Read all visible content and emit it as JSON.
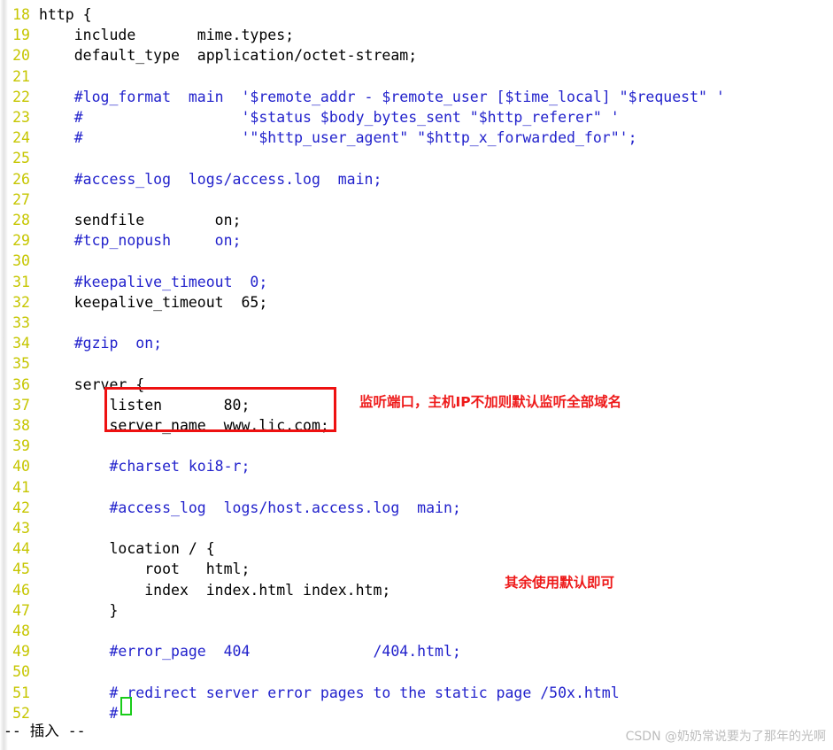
{
  "editor": {
    "mode_status": "-- 插入 --",
    "colors": {
      "line_number": "#c6c600",
      "comment": "#2222cc",
      "code": "#000000",
      "background": "#ffffff",
      "annotation_red": "#ee1a1a",
      "highlight_box": "#ee1111",
      "cursor_green": "#19cc19",
      "watermark": "#bdbdbd"
    },
    "lines": [
      {
        "n": "18",
        "text": "http {",
        "comment": false
      },
      {
        "n": "19",
        "text": "    include       mime.types;",
        "comment": false
      },
      {
        "n": "20",
        "text": "    default_type  application/octet-stream;",
        "comment": false
      },
      {
        "n": "21",
        "text": "",
        "comment": false
      },
      {
        "n": "22",
        "text": "    #log_format  main  '$remote_addr - $remote_user [$time_local] \"$request\" '",
        "comment": true
      },
      {
        "n": "23",
        "text": "    #                  '$status $body_bytes_sent \"$http_referer\" '",
        "comment": true
      },
      {
        "n": "24",
        "text": "    #                  '\"$http_user_agent\" \"$http_x_forwarded_for\"';",
        "comment": true
      },
      {
        "n": "25",
        "text": "",
        "comment": false
      },
      {
        "n": "26",
        "text": "    #access_log  logs/access.log  main;",
        "comment": true
      },
      {
        "n": "27",
        "text": "",
        "comment": false
      },
      {
        "n": "28",
        "text": "    sendfile        on;",
        "comment": false
      },
      {
        "n": "29",
        "text": "    #tcp_nopush     on;",
        "comment": true
      },
      {
        "n": "30",
        "text": "",
        "comment": false
      },
      {
        "n": "31",
        "text": "    #keepalive_timeout  0;",
        "comment": true
      },
      {
        "n": "32",
        "text": "    keepalive_timeout  65;",
        "comment": false
      },
      {
        "n": "33",
        "text": "",
        "comment": false
      },
      {
        "n": "34",
        "text": "    #gzip  on;",
        "comment": true
      },
      {
        "n": "35",
        "text": "",
        "comment": false
      },
      {
        "n": "36",
        "text": "    server {",
        "comment": false
      },
      {
        "n": "37",
        "text": "        listen       80;",
        "comment": false
      },
      {
        "n": "38",
        "text": "        server_name  www.lic.com;",
        "comment": false
      },
      {
        "n": "39",
        "text": "",
        "comment": false
      },
      {
        "n": "40",
        "text": "        #charset koi8-r;",
        "comment": true
      },
      {
        "n": "41",
        "text": "",
        "comment": false
      },
      {
        "n": "42",
        "text": "        #access_log  logs/host.access.log  main;",
        "comment": true
      },
      {
        "n": "43",
        "text": "",
        "comment": false
      },
      {
        "n": "44",
        "text": "        location / {",
        "comment": false
      },
      {
        "n": "45",
        "text": "            root   html;",
        "comment": false
      },
      {
        "n": "46",
        "text": "            index  index.html index.htm;",
        "comment": false
      },
      {
        "n": "47",
        "text": "        }",
        "comment": false
      },
      {
        "n": "48",
        "text": "",
        "comment": false
      },
      {
        "n": "49",
        "text": "        #error_page  404              /404.html;",
        "comment": true
      },
      {
        "n": "50",
        "text": "",
        "comment": false
      },
      {
        "n": "51",
        "text": "        # redirect server error pages to the static page /50x.html",
        "comment": true
      },
      {
        "n": "52",
        "text": "        #",
        "comment": true
      }
    ]
  },
  "annotations": [
    {
      "id": "listen-note",
      "text": "监听端口，主机IP不加则默认监听全部域名"
    },
    {
      "id": "default-note",
      "text": "其余使用默认即可"
    }
  ],
  "highlight": {
    "label": "listen-and-server-name-box",
    "lines": [
      "listen       80;",
      "server_name  www.lic.com;"
    ]
  },
  "watermark": {
    "text": "CSDN @奶奶常说要为了那年的光啊"
  }
}
